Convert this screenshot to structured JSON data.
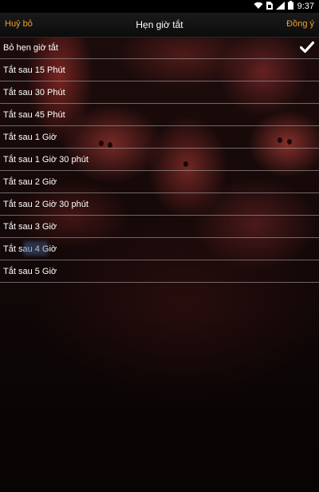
{
  "status_bar": {
    "time": "9:37",
    "icons": [
      "wifi-icon",
      "sim-icon",
      "signal-icon",
      "battery-icon"
    ]
  },
  "header": {
    "cancel_label": "Huỷ bỏ",
    "title": "Hẹn giờ tắt",
    "ok_label": "Đồng ý",
    "accent_color": "#f0a030"
  },
  "options": [
    {
      "label": "Bỏ hẹn giờ tắt",
      "selected": true
    },
    {
      "label": "Tắt sau 15 Phút",
      "selected": false
    },
    {
      "label": "Tắt sau 30 Phút",
      "selected": false
    },
    {
      "label": "Tắt sau 45 Phút",
      "selected": false
    },
    {
      "label": "Tắt sau 1 Giờ",
      "selected": false
    },
    {
      "label": "Tắt sau 1 Giờ 30 phút",
      "selected": false
    },
    {
      "label": "Tắt sau 2 Giờ",
      "selected": false
    },
    {
      "label": "Tắt sau 2 Giờ 30 phút",
      "selected": false
    },
    {
      "label": "Tắt sau 3 Giờ",
      "selected": false
    },
    {
      "label": "Tắt sau 4 Giờ",
      "selected": false
    },
    {
      "label": "Tắt sau 5 Giờ",
      "selected": false
    }
  ]
}
